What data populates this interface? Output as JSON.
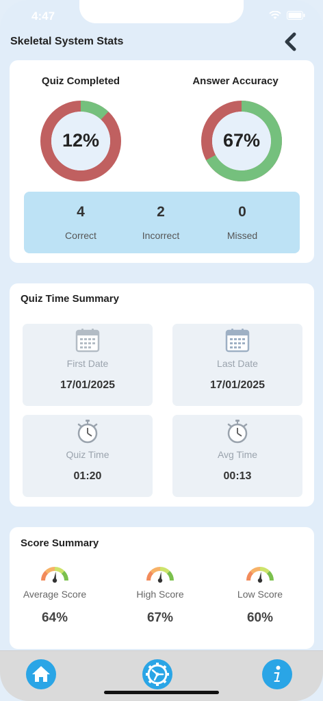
{
  "status_bar": {
    "time": "4:47"
  },
  "header": {
    "title": "Skeletal System Stats"
  },
  "overview": {
    "quiz_completed": {
      "title": "Quiz Completed",
      "label": "12%",
      "fraction": 0.12
    },
    "answer_accuracy": {
      "title": "Answer Accuracy",
      "label": "67%",
      "fraction": 0.67
    },
    "colors": {
      "filled": "#75c07d",
      "remaining": "#c06060",
      "inner": "#e6f0fa"
    },
    "stats": [
      {
        "value": "4",
        "label": "Correct"
      },
      {
        "value": "2",
        "label": "Incorrect"
      },
      {
        "value": "0",
        "label": "Missed"
      }
    ]
  },
  "time_summary": {
    "title": "Quiz Time Summary",
    "tiles": [
      {
        "icon": "calendar-icon",
        "label": "First Date",
        "value": "17/01/2025"
      },
      {
        "icon": "calendar-icon",
        "label": "Last Date",
        "value": "17/01/2025"
      },
      {
        "icon": "stopwatch-icon",
        "label": "Quiz Time",
        "value": "01:20"
      },
      {
        "icon": "stopwatch-icon",
        "label": "Avg Time",
        "value": "00:13"
      }
    ]
  },
  "score_summary": {
    "title": "Score Summary",
    "items": [
      {
        "icon": "gauge-icon",
        "label": "Average Score",
        "value": "64%"
      },
      {
        "icon": "gauge-icon",
        "label": "High Score",
        "value": "67%"
      },
      {
        "icon": "gauge-icon",
        "label": "Low Score",
        "value": "60%"
      }
    ]
  },
  "tab_bar": {
    "items": [
      {
        "icon": "home-icon"
      },
      {
        "icon": "settings-gear-icon"
      },
      {
        "icon": "info-icon"
      }
    ],
    "accent": "#2aa5e6"
  }
}
